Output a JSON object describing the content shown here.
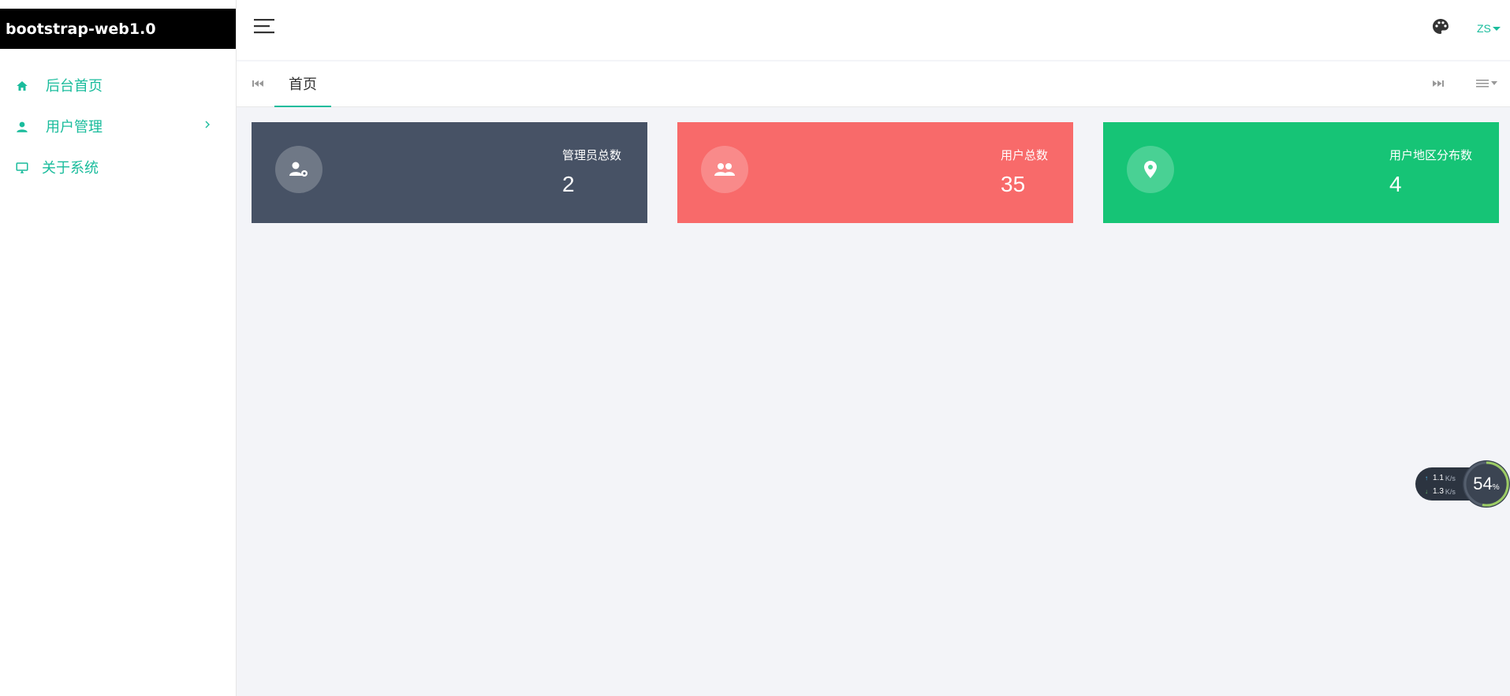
{
  "app": {
    "brand": "bootstrap-web1.0"
  },
  "sidebar": {
    "items": [
      {
        "label": "后台首页",
        "icon": "home-icon"
      },
      {
        "label": "用户管理",
        "icon": "user-icon",
        "has_children": true
      },
      {
        "label": "关于系统",
        "icon": "monitor-icon"
      }
    ]
  },
  "header": {
    "user": "ZS",
    "icons": [
      "menu-icon",
      "palette-icon"
    ]
  },
  "tabs": [
    {
      "label": "首页",
      "active": true
    }
  ],
  "stats": [
    {
      "title": "管理员总数",
      "value": "2",
      "icon": "user-gear-icon",
      "color": "#475265"
    },
    {
      "title": "用户总数",
      "value": "35",
      "icon": "users-icon",
      "color": "#f86a6a"
    },
    {
      "title": "用户地区分布数",
      "value": "4",
      "icon": "map-pin-icon",
      "color": "#16c476"
    }
  ],
  "speed_widget": {
    "upload": "1.1",
    "upload_unit": "K/s",
    "download": "1.3",
    "download_unit": "K/s",
    "percent": "54",
    "percent_sign": "%"
  },
  "colors": {
    "accent": "#1abc9c",
    "brand_bg": "#000000",
    "content_bg": "#f3f4f8"
  }
}
